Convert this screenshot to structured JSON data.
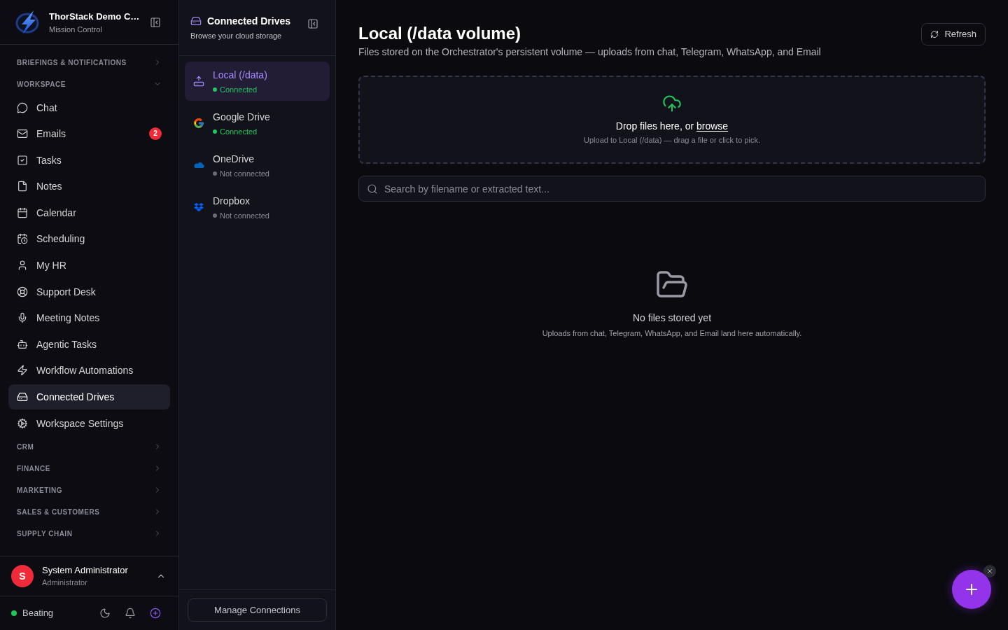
{
  "sidebar": {
    "brand": {
      "title": "ThorStack Demo C…",
      "subtitle": "Mission Control"
    },
    "sections": [
      {
        "label": "BRIEFINGS & NOTIFICATIONS",
        "expanded": false
      },
      {
        "label": "WORKSPACE",
        "expanded": true,
        "items": [
          {
            "label": "Chat",
            "selected": false
          },
          {
            "label": "Emails",
            "selected": false,
            "badge": "2"
          },
          {
            "label": "Tasks",
            "selected": false
          },
          {
            "label": "Notes",
            "selected": false
          },
          {
            "label": "Calendar",
            "selected": false
          },
          {
            "label": "Scheduling",
            "selected": false
          },
          {
            "label": "My HR",
            "selected": false
          },
          {
            "label": "Support Desk",
            "selected": false
          },
          {
            "label": "Meeting Notes",
            "selected": false
          },
          {
            "label": "Agentic Tasks",
            "selected": false
          },
          {
            "label": "Workflow Automations",
            "selected": false
          },
          {
            "label": "Connected Drives",
            "selected": true
          },
          {
            "label": "Workspace Settings",
            "selected": false
          }
        ]
      },
      {
        "label": "CRM",
        "expanded": false
      },
      {
        "label": "FINANCE",
        "expanded": false
      },
      {
        "label": "MARKETING",
        "expanded": false
      },
      {
        "label": "SALES & CUSTOMERS",
        "expanded": false
      },
      {
        "label": "SUPPLY CHAIN",
        "expanded": false
      }
    ],
    "user": {
      "initial": "S",
      "name": "System Administrator",
      "role": "Administrator"
    },
    "status": {
      "label": "Beating"
    }
  },
  "drives_panel": {
    "title": "Connected Drives",
    "subtitle": "Browse your cloud storage",
    "drives": [
      {
        "name": "Local (/data)",
        "status": "Connected",
        "connected": true,
        "selected": true
      },
      {
        "name": "Google Drive",
        "status": "Connected",
        "connected": true,
        "selected": false
      },
      {
        "name": "OneDrive",
        "status": "Not connected",
        "connected": false,
        "selected": false
      },
      {
        "name": "Dropbox",
        "status": "Not connected",
        "connected": false,
        "selected": false
      }
    ],
    "manage_button": "Manage Connections"
  },
  "main": {
    "title": "Local (/data volume)",
    "subtitle": "Files stored on the Orchestrator's persistent volume — uploads from chat, Telegram, WhatsApp, and Email",
    "refresh_button": "Refresh",
    "dropzone": {
      "text": "Drop files here, or",
      "link": "browse",
      "hint": "Upload to Local (/data) — drag a file or click to pick."
    },
    "search": {
      "placeholder": "Search by filename or extracted text..."
    },
    "empty_state": {
      "title": "No files stored yet",
      "text": "Uploads from chat, Telegram, WhatsApp, and Email land here automatically."
    }
  }
}
